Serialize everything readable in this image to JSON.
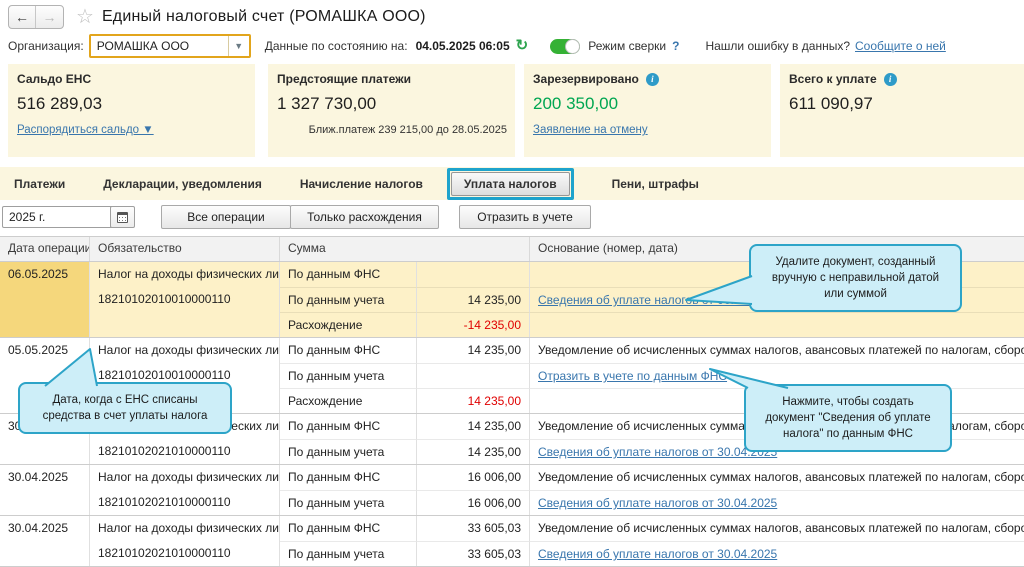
{
  "header": {
    "title": "Единый налоговый счет (РОМАШКА ООО)"
  },
  "nav": {
    "back_icon": "←",
    "forward_icon": "→",
    "favorite_icon": "☆"
  },
  "filter": {
    "org_label": "Организация:",
    "org_value": "РОМАШКА ООО",
    "org_dropdown_icon": "▼",
    "as_of_label": "Данные по состоянию на:",
    "as_of_value": "04.05.2025 06:05",
    "refresh_icon": "↻",
    "reconcile_label": "Режим сверки",
    "reconcile_help_icon": "?",
    "error_prompt": "Нашли ошибку в данных?",
    "error_link": "Сообщите о ней"
  },
  "cards": [
    {
      "title": "Сальдо ЕНС",
      "value": "516 289,03",
      "link": "Распорядиться сальдо ▼"
    },
    {
      "title": "Предстоящие платежи",
      "value": "1 327 730,00",
      "note": "Ближ.платеж 239 215,00 до 28.05.2025"
    },
    {
      "title": "Зарезервировано",
      "info_icon": "i",
      "value": "200 350,00",
      "link": "Заявление на отмену"
    },
    {
      "title": "Всего к уплате",
      "info_icon": "i",
      "value": "611 090,97"
    }
  ],
  "tabs": [
    {
      "label": "Платежи"
    },
    {
      "label": "Декларации, уведомления"
    },
    {
      "label": "Начисление налогов"
    },
    {
      "label": "Уплата налогов",
      "selected": true
    },
    {
      "label": "Пени, штрафы"
    }
  ],
  "toolbar": {
    "period_value": "2025 г.",
    "all_operations": "Все операции",
    "only_discrepancies": "Только расхождения",
    "reflect": "Отразить в учете"
  },
  "table": {
    "headers": {
      "date": "Дата операции",
      "obligation": "Обязательство",
      "sum": "Сумма",
      "basis": "Основание (номер, дата)"
    },
    "groups": [
      {
        "date": "06.05.2025",
        "obligation": "Налог на доходы физических лиц",
        "kbk": "18210102010010000110",
        "rows": [
          {
            "label": "По данным ФНС",
            "value": "",
            "basis": ""
          },
          {
            "label": "По данным учета",
            "value": "14 235,00",
            "basis": "Сведения об уплате налогов от 06.05.2025"
          },
          {
            "label": "Расхождение",
            "value": "-14 235,00",
            "basis": ""
          }
        ]
      },
      {
        "date": "05.05.2025",
        "obligation": "Налог на доходы физических лиц",
        "kbk": "18210102010010000110",
        "rows": [
          {
            "label": "По данным ФНС",
            "value": "14 235,00",
            "basis": "Уведомление об исчисленных суммах налогов, авансовых платежей по налогам, сборов, стра"
          },
          {
            "label": "По данным учета",
            "value": "",
            "basis": "Отразить в учете по данным ФНС"
          },
          {
            "label": "Расхождение",
            "value": "14 235,00",
            "basis": ""
          }
        ]
      },
      {
        "date": "30.04.2025",
        "obligation": "Налог на доходы физических лиц",
        "kbk": "18210102021010000110",
        "rows": [
          {
            "label": "По данным ФНС",
            "value": "14 235,00",
            "basis": "Уведомление об исчисленных суммах налогов, авансовых платежей по налогам, сборов, стра"
          },
          {
            "label": "По данным учета",
            "value": "14 235,00",
            "basis": "Сведения об уплате налогов от 30.04.2025"
          }
        ]
      },
      {
        "date": "30.04.2025",
        "obligation": "Налог на доходы физических лиц",
        "kbk": "18210102021010000110",
        "rows": [
          {
            "label": "По данным ФНС",
            "value": "16 006,00",
            "basis": "Уведомление об исчисленных суммах налогов, авансовых платежей по налогам, сборов, стра"
          },
          {
            "label": "По данным учета",
            "value": "16 006,00",
            "basis": "Сведения об уплате налогов от 30.04.2025"
          }
        ]
      },
      {
        "date": "30.04.2025",
        "obligation": "Налог на доходы физических лиц",
        "kbk": "18210102021010000110",
        "rows": [
          {
            "label": "По данным ФНС",
            "value": "33 605,03",
            "basis": "Уведомление об исчисленных суммах налогов, авансовых платежей по налогам, сборов, стра"
          },
          {
            "label": "По данным учета",
            "value": "33 605,03",
            "basis": "Сведения об уплате налогов от 30.04.2025"
          }
        ]
      }
    ]
  },
  "callouts": {
    "delete_doc": "Удалите документ, созданный вручную с неправильной датой или суммой",
    "date_info": "Дата, когда с ЕНС списаны средства в счет уплаты налога",
    "create_doc": "Нажмите, чтобы создать документ \"Сведения об уплате налога\" по данным ФНС"
  },
  "colors": {
    "accent_teal": "#2da4c8",
    "card_bg": "#fbf6df",
    "highlight_bg": "#fdf1c8",
    "highlight_date_bg": "#f5d77c",
    "link": "#3976ad",
    "red": "#e00000",
    "green": "#00a651"
  }
}
